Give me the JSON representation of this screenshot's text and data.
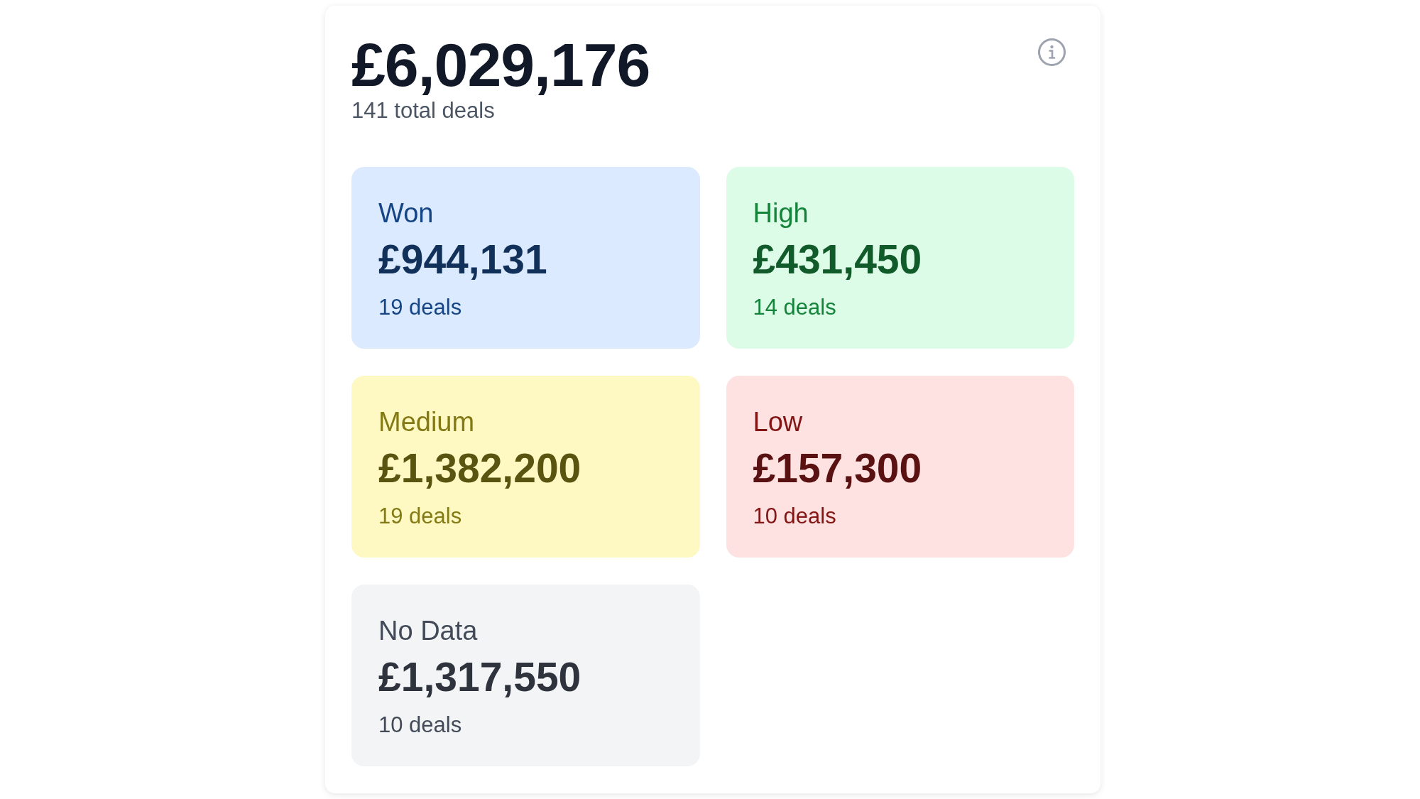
{
  "summary": {
    "total_value": "£6,029,176",
    "total_deals": "141 total deals"
  },
  "categories": [
    {
      "label": "Won",
      "value": "£944,131",
      "deals": "19 deals",
      "color": "#dbeafe"
    },
    {
      "label": "High",
      "value": "£431,450",
      "deals": "14 deals",
      "color": "#dcfce7"
    },
    {
      "label": "Medium",
      "value": "£1,382,200",
      "deals": "19 deals",
      "color": "#fef9c3"
    },
    {
      "label": "Low",
      "value": "£157,300",
      "deals": "10 deals",
      "color": "#fee2e2"
    },
    {
      "label": "No Data",
      "value": "£1,317,550",
      "deals": "10 deals",
      "color": "#f3f4f6"
    }
  ]
}
